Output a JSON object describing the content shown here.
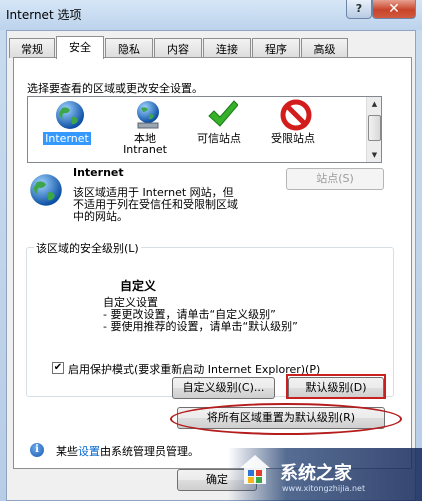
{
  "window": {
    "title": "Internet 选项",
    "help_label": "?",
    "close_label": "✕"
  },
  "tabs": [
    {
      "label": "常规"
    },
    {
      "label": "安全"
    },
    {
      "label": "隐私"
    },
    {
      "label": "内容"
    },
    {
      "label": "连接"
    },
    {
      "label": "程序"
    },
    {
      "label": "高级"
    }
  ],
  "active_tab": "安全",
  "security": {
    "prompt": "选择要查看的区域或更改安全设置。",
    "zones": [
      {
        "label": "Internet",
        "icon": "globe-icon",
        "selected": true
      },
      {
        "label": "本地\nIntranet",
        "line1": "本地",
        "line2": "Intranet",
        "icon": "intranet-globe-icon"
      },
      {
        "label": "可信站点",
        "icon": "check-icon"
      },
      {
        "label": "受限站点",
        "icon": "restricted-icon"
      }
    ],
    "zone_title": "Internet",
    "zone_desc_1": "该区域适用于 Internet 网站，但",
    "zone_desc_2": "不适用于列在受信任和受限制区域",
    "zone_desc_3": "中的网站。",
    "sites_button": "站点(S)",
    "level_group_title": "该区域的安全级别(L)",
    "level_name": "自定义",
    "level_desc_1": "自定义设置",
    "level_desc_2": "- 要更改设置，请单击“自定义级别”",
    "level_desc_3": "- 要使用推荐的设置，请单击“默认级别”",
    "protected_mode_label": "启用保护模式(要求重新启动 Internet Explorer)(P)",
    "protected_mode_checked": true,
    "custom_level_button": "自定义级别(C)...",
    "default_level_button": "默认级别(D)",
    "reset_all_button": "将所有区域重置为默认级别(R)",
    "admin_note_prefix": "某些",
    "admin_note_link": "设置",
    "admin_note_suffix": "由系统管理员管理。"
  },
  "footer": {
    "ok_button": "确定"
  },
  "watermark": {
    "text": "系统之家",
    "url": "www.xitongzhijia.net"
  },
  "colors": {
    "selection": "#3399ff",
    "highlight_red": "#c92020"
  }
}
